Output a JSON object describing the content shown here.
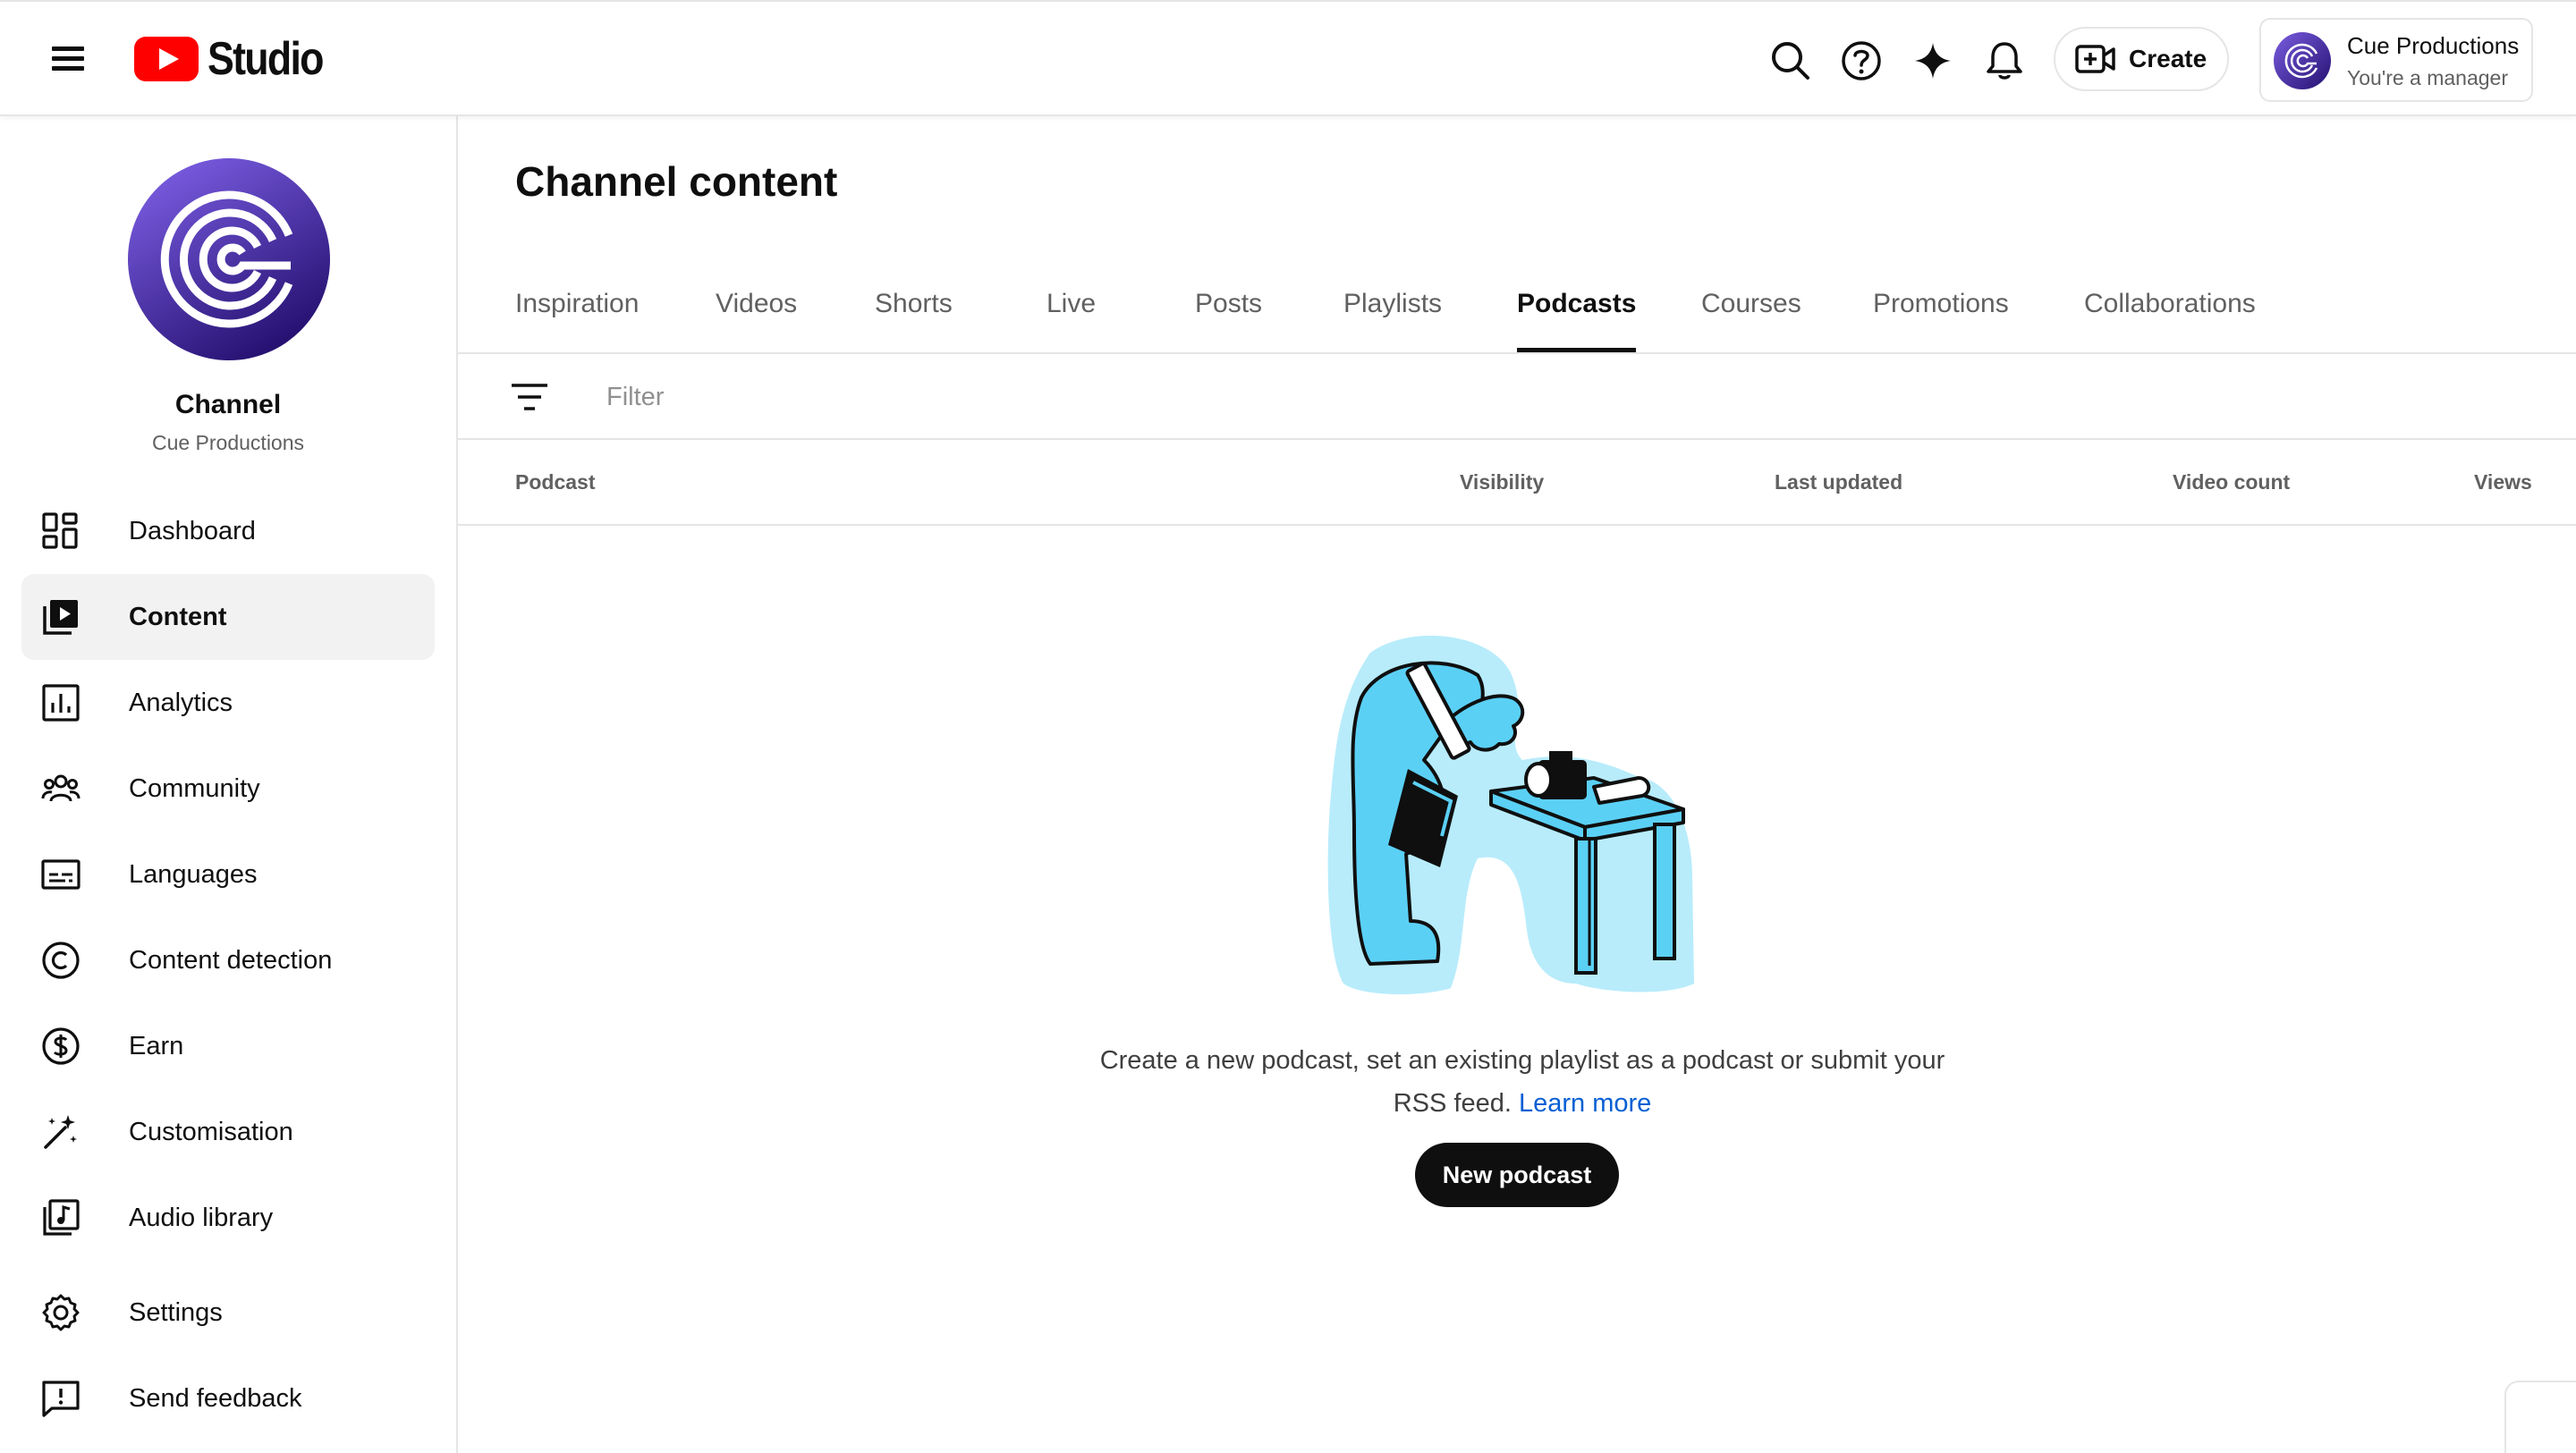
{
  "header": {
    "logo_text": "Studio",
    "create_label": "Create",
    "account_name": "Cue Productions",
    "account_role": "You're a manager",
    "icons": [
      "menu-icon",
      "youtube-logo-icon",
      "search-icon",
      "help-icon",
      "sparkle-icon",
      "bell-icon",
      "create-video-icon"
    ]
  },
  "sidebar": {
    "channel_title": "Channel",
    "channel_name": "Cue Productions",
    "items": [
      {
        "label": "Dashboard",
        "icon": "dashboard-icon"
      },
      {
        "label": "Content",
        "icon": "content-icon",
        "active": true
      },
      {
        "label": "Analytics",
        "icon": "analytics-icon"
      },
      {
        "label": "Community",
        "icon": "community-icon"
      },
      {
        "label": "Languages",
        "icon": "subtitles-icon"
      },
      {
        "label": "Content detection",
        "icon": "copyright-icon"
      },
      {
        "label": "Earn",
        "icon": "dollar-icon"
      },
      {
        "label": "Customisation",
        "icon": "magic-wand-icon"
      },
      {
        "label": "Audio library",
        "icon": "audio-library-icon"
      },
      {
        "label": "Settings",
        "icon": "gear-icon"
      },
      {
        "label": "Send feedback",
        "icon": "feedback-icon"
      }
    ]
  },
  "main": {
    "title": "Channel content",
    "tabs": [
      {
        "label": "Inspiration"
      },
      {
        "label": "Videos"
      },
      {
        "label": "Shorts"
      },
      {
        "label": "Live"
      },
      {
        "label": "Posts"
      },
      {
        "label": "Playlists"
      },
      {
        "label": "Podcasts",
        "active": true
      },
      {
        "label": "Courses"
      },
      {
        "label": "Promotions"
      },
      {
        "label": "Collaborations"
      }
    ],
    "filter_placeholder": "Filter",
    "columns": [
      "Podcast",
      "Visibility",
      "Last updated",
      "Video count",
      "Views"
    ],
    "empty_text": "Create a new podcast, set an existing playlist as a podcast or submit your RSS feed.",
    "learn_more": "Learn more",
    "new_podcast_label": "New podcast"
  },
  "colors": {
    "youtube_red": "#ff0000",
    "text_primary": "#0f0f0f",
    "text_secondary": "#606060",
    "link": "#065fd4",
    "illustration_blue": "#5bd0f5",
    "illustration_light": "#b8ecfb",
    "avatar_purple": "#4b2aa5"
  }
}
